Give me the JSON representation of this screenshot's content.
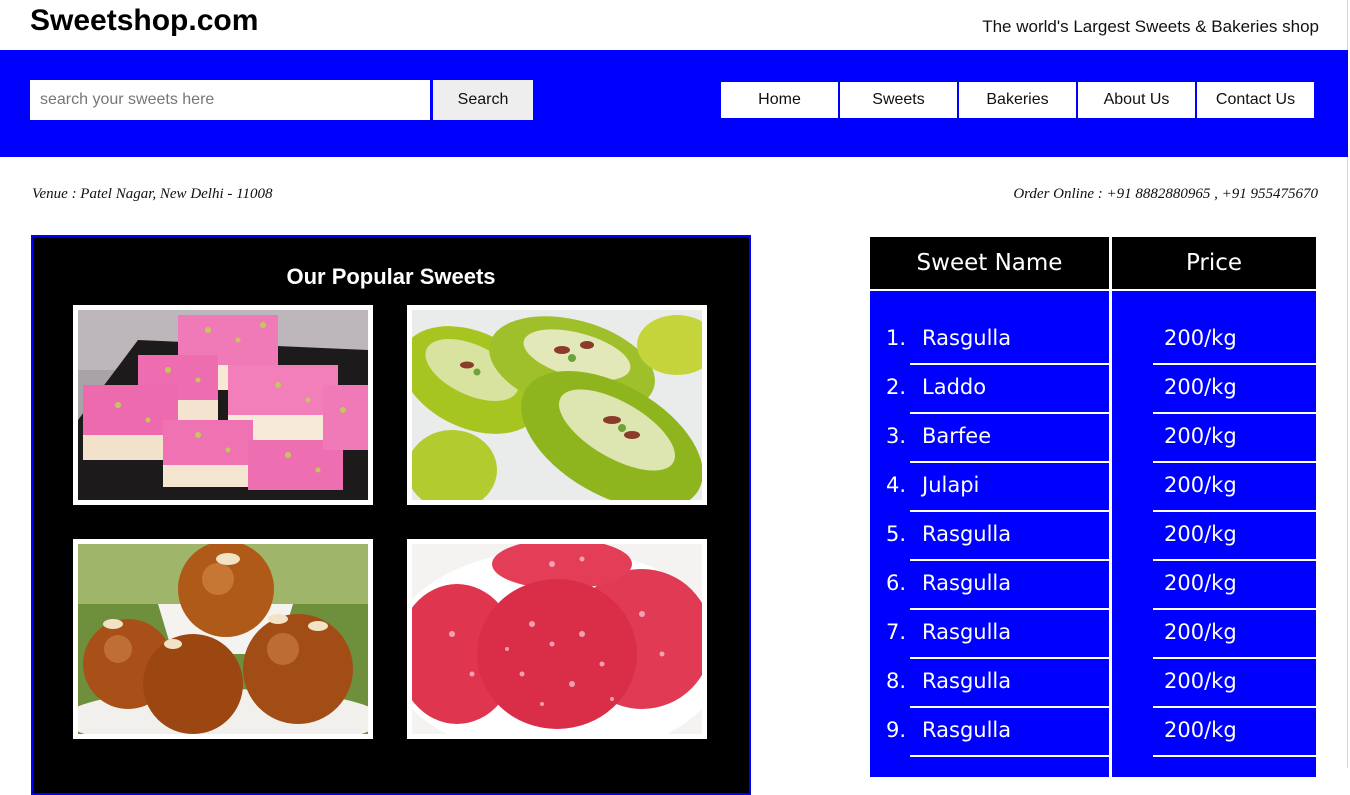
{
  "header": {
    "title": "Sweetshop.com",
    "tagline": "The world's Largest Sweets & Bakeries shop"
  },
  "search": {
    "placeholder": "search your sweets here",
    "value": "",
    "button_label": "Search"
  },
  "nav": {
    "items": [
      "Home",
      "Sweets",
      "Bakeries",
      "About Us",
      "Contact Us"
    ]
  },
  "info": {
    "venue": "Venue : Patel Nagar, New Delhi - 11008",
    "order": "Order Online : +91 8882880965 , +91 955475670"
  },
  "popular": {
    "title": "Our Popular Sweets",
    "images": [
      "barfi-photo",
      "green-sweet-photo",
      "gulab-jamun-photo",
      "red-coconut-sweet-photo"
    ]
  },
  "price_table": {
    "headers": [
      "Sweet Name",
      "Price"
    ],
    "rows": [
      {
        "num": "1.",
        "name": "Rasgulla",
        "price": "200/kg"
      },
      {
        "num": "2.",
        "name": "Laddo",
        "price": "200/kg"
      },
      {
        "num": "3.",
        "name": "Barfee",
        "price": "200/kg"
      },
      {
        "num": "4.",
        "name": "Julapi",
        "price": "200/kg"
      },
      {
        "num": "5.",
        "name": "Rasgulla",
        "price": "200/kg"
      },
      {
        "num": "6.",
        "name": "Rasgulla",
        "price": "200/kg"
      },
      {
        "num": "7.",
        "name": "Rasgulla",
        "price": "200/kg"
      },
      {
        "num": "8.",
        "name": "Rasgulla",
        "price": "200/kg"
      },
      {
        "num": "9.",
        "name": "Rasgulla",
        "price": "200/kg"
      }
    ]
  },
  "colors": {
    "nav_bg": "#0000ff",
    "panel_bg": "#000000",
    "table_header_bg": "#000000",
    "table_body_bg": "#0000ff"
  }
}
